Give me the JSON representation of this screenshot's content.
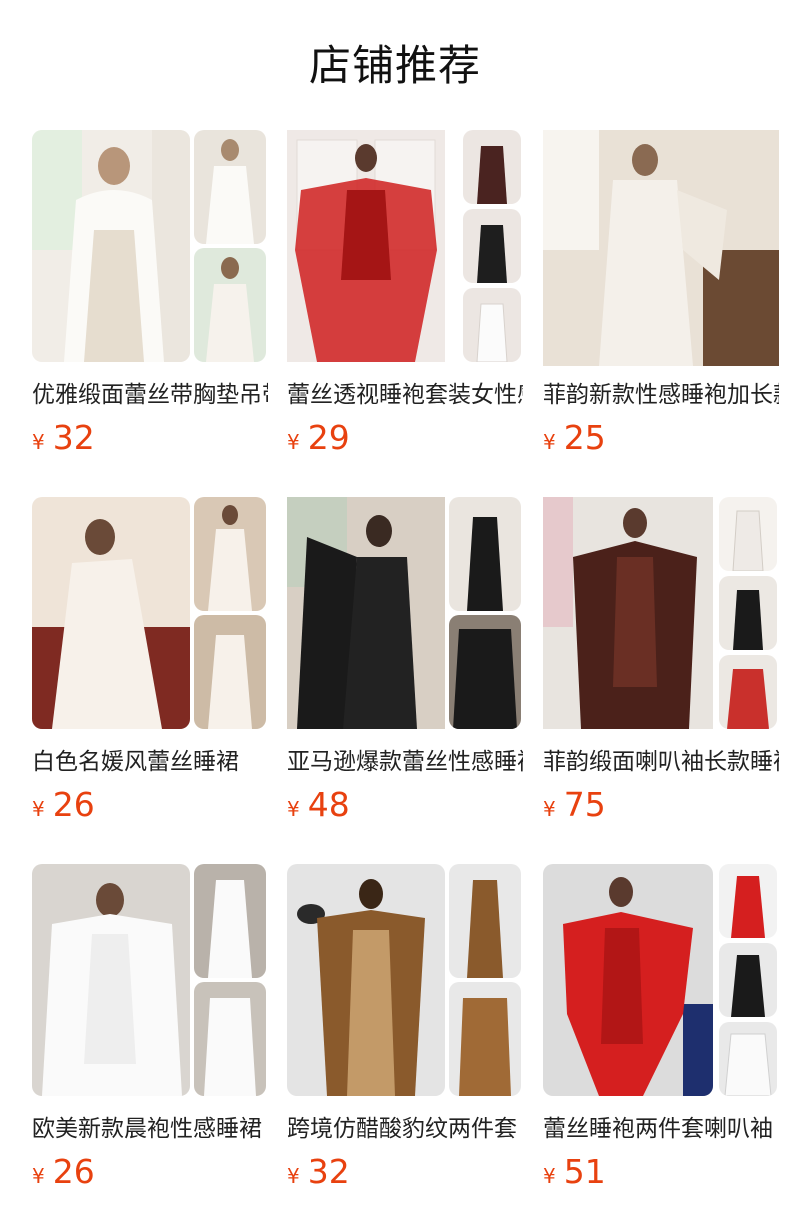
{
  "section": {
    "title": "店铺推荐"
  },
  "colors": {
    "price": "#e8410f",
    "text": "#222222"
  },
  "products": [
    {
      "name": "优雅缎面蕾丝带胸垫吊带睡裙",
      "currency": "¥",
      "price": "32",
      "palette": [
        "#f1ede7",
        "#dcd2c4",
        "#b8a890",
        "#fbfaf7"
      ]
    },
    {
      "name": "蕾丝透视睡袍套装女性感",
      "currency": "¥",
      "price": "29",
      "palette": [
        "#efe9e6",
        "#cf1f1f",
        "#4a2320",
        "#f6f3f1"
      ]
    },
    {
      "name": "菲韵新款性感睡袍加长款",
      "currency": "¥",
      "price": "25",
      "palette": [
        "#e9e1d6",
        "#f4f0ea",
        "#6b4a33",
        "#c9b8a1"
      ]
    },
    {
      "name": "白色名媛风蕾丝睡裙",
      "currency": "¥",
      "price": "26",
      "palette": [
        "#efe4d8",
        "#f7f1ea",
        "#7f2a22",
        "#d9c8b5"
      ]
    },
    {
      "name": "亚马逊爆款蕾丝性感睡裙",
      "currency": "¥",
      "price": "48",
      "palette": [
        "#d8cfc4",
        "#1a1a1a",
        "#8a7f74",
        "#eae5df"
      ]
    },
    {
      "name": "菲韵缎面喇叭袖长款睡袍",
      "currency": "¥",
      "price": "75",
      "palette": [
        "#e8e4df",
        "#4b211a",
        "#c9302c",
        "#f5f2ee"
      ]
    },
    {
      "name": "欧美新款晨袍性感睡裙",
      "currency": "¥",
      "price": "26",
      "palette": [
        "#d9d5d0",
        "#fafafa",
        "#b9b2aa",
        "#eeeae6"
      ]
    },
    {
      "name": "跨境仿醋酸豹纹两件套",
      "currency": "¥",
      "price": "32",
      "palette": [
        "#e4e4e4",
        "#8a5a2c",
        "#3a2616",
        "#c39a68"
      ]
    },
    {
      "name": "蕾丝睡袍两件套喇叭袖",
      "currency": "¥",
      "price": "51",
      "palette": [
        "#dcdcdc",
        "#d51f1f",
        "#1e2f6e",
        "#f2f2f2"
      ]
    }
  ]
}
